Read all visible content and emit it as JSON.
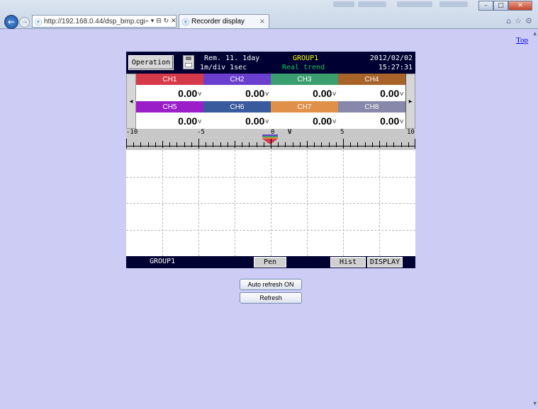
{
  "browser": {
    "address_url": "http://192.168.0.44/dsp_bmp.cgi",
    "address_controls": "⌕ ▾ ⊟ ↻ ✕",
    "tab_title": "Recorder display",
    "tab_close": "×",
    "win_minimize": "–",
    "win_maximize": "□",
    "win_close": "✕",
    "icon_home": "⌂",
    "icon_favorites": "☆",
    "icon_tools": "⚙",
    "back_glyph": "←",
    "forward_glyph": "→"
  },
  "page": {
    "top_link": "Top",
    "auto_refresh_label": "Auto refresh ON",
    "refresh_label": "Refresh"
  },
  "recorder": {
    "operation_label": "Operation",
    "remaining": "Rem. 11. 1day",
    "div": "1m/div 1sec",
    "group": "GROUP1",
    "mode": "Real trend",
    "date": "2012/02/02",
    "time": "15:27:31",
    "left_arrow": "◀",
    "right_arrow": "▶",
    "channels": [
      {
        "label": "CH1",
        "value": "0.00",
        "unit": "V",
        "color": "#d63a4a"
      },
      {
        "label": "CH2",
        "value": "0.00",
        "unit": "V",
        "color": "#6a3fcf"
      },
      {
        "label": "CH3",
        "value": "0.00",
        "unit": "V",
        "color": "#3a9e6e"
      },
      {
        "label": "CH4",
        "value": "0.00",
        "unit": "V",
        "color": "#a86328"
      },
      {
        "label": "CH5",
        "value": "0.00",
        "unit": "V",
        "color": "#9a1fc8"
      },
      {
        "label": "CH6",
        "value": "0.00",
        "unit": "V",
        "color": "#3a5a9e"
      },
      {
        "label": "CH7",
        "value": "0.00",
        "unit": "V",
        "color": "#e09048"
      },
      {
        "label": "CH8",
        "value": "0.00",
        "unit": "V",
        "color": "#8888aa"
      }
    ],
    "scale": {
      "labels": [
        "-10",
        "-5",
        "0",
        "5",
        "10"
      ],
      "unit": "V"
    },
    "bottom": {
      "group": "GROUP1",
      "pen_label": "Pen",
      "hist_label": "Hist",
      "display_label": "DISPLAY"
    }
  }
}
